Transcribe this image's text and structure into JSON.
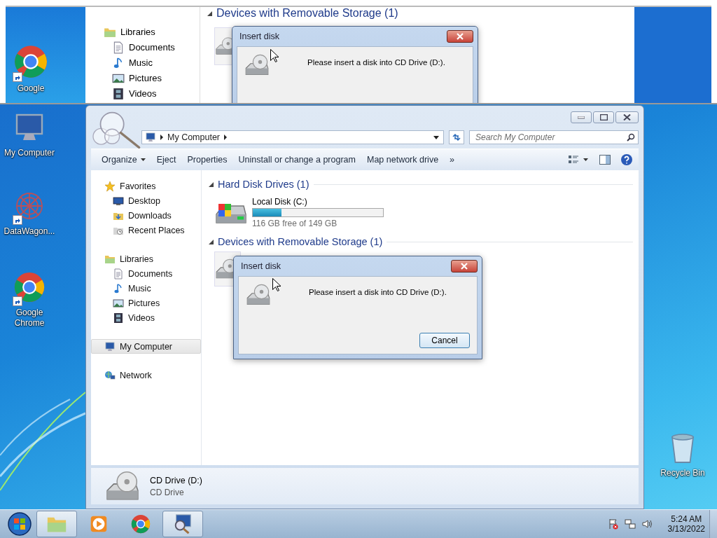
{
  "magnifier": {
    "desktop_icon": {
      "label": "Google"
    },
    "sidebar": [
      {
        "label": "Libraries"
      },
      {
        "label": "Documents"
      },
      {
        "label": "Music"
      },
      {
        "label": "Pictures"
      },
      {
        "label": "Videos"
      }
    ],
    "group_header": "Devices with Removable Storage (1)",
    "dialog": {
      "title": "Insert disk",
      "message": "Please insert a disk into CD Drive (D:)."
    }
  },
  "desktop_icons": [
    {
      "label": "My Computer"
    },
    {
      "label": "DataWagon..."
    },
    {
      "label": "Google Chrome"
    },
    {
      "label": "Recycle Bin"
    }
  ],
  "explorer": {
    "address": [
      "My Computer"
    ],
    "search": {
      "placeholder": "Search My Computer"
    },
    "toolbar": [
      {
        "label": "Organize",
        "dropdown": true
      },
      {
        "label": "Eject",
        "dropdown": false
      },
      {
        "label": "Properties",
        "dropdown": false
      },
      {
        "label": "Uninstall or change a program",
        "dropdown": false
      },
      {
        "label": "Map network drive",
        "dropdown": false
      },
      {
        "label": "»",
        "dropdown": false
      }
    ],
    "sidebar": [
      {
        "label": "Favorites",
        "selected": false,
        "children": [
          {
            "label": "Desktop",
            "selected": false
          },
          {
            "label": "Downloads",
            "selected": false
          },
          {
            "label": "Recent Places",
            "selected": false
          }
        ]
      },
      {
        "label": "Libraries",
        "selected": false,
        "children": [
          {
            "label": "Documents",
            "selected": false
          },
          {
            "label": "Music",
            "selected": false
          },
          {
            "label": "Pictures",
            "selected": false
          },
          {
            "label": "Videos",
            "selected": false
          }
        ]
      },
      {
        "label": "My Computer",
        "selected": true
      },
      {
        "label": "Network",
        "selected": false
      }
    ],
    "groups": [
      {
        "title": "Hard Disk Drives (1)",
        "expanded": true,
        "items": [
          {
            "name": "Local Disk (C:)",
            "level": 0.22,
            "free": "116 GB free of 149 GB"
          }
        ]
      },
      {
        "title": "Devices with Removable Storage (1)",
        "expanded": true,
        "items": [
          {
            "kind": "covered"
          }
        ]
      }
    ],
    "details": {
      "name": "CD Drive (D:)",
      "type": "CD Drive"
    }
  },
  "dialog": {
    "title": "Insert disk",
    "message": "Please insert a disk into CD Drive (D:).",
    "buttons": [
      "Cancel"
    ]
  },
  "taskbar": {
    "apps": [
      {
        "active": true
      },
      {
        "active": false
      },
      {
        "active": false
      },
      {
        "active": true
      }
    ],
    "time": "5:24 AM",
    "date": "3/13/2022"
  }
}
